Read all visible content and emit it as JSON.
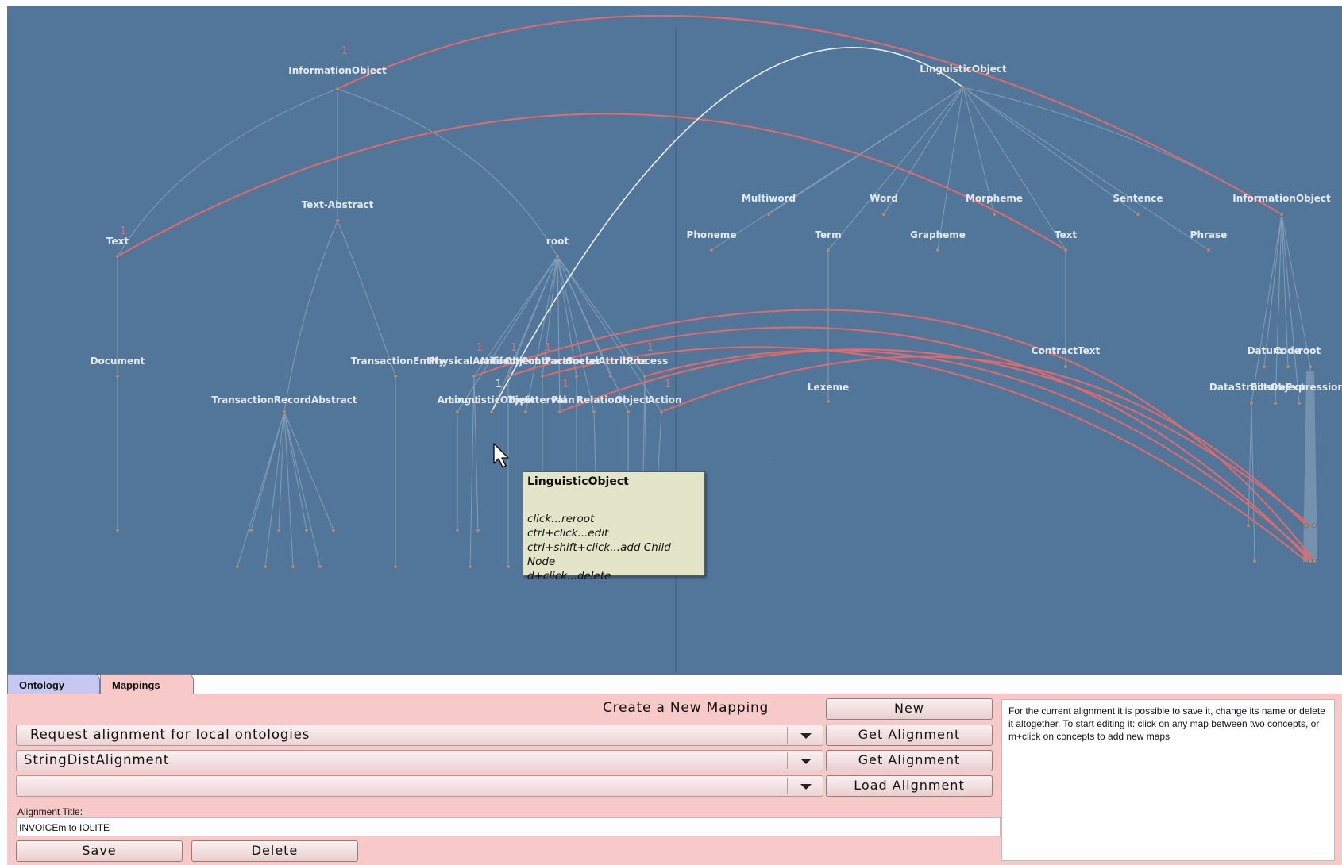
{
  "colors": {
    "canvas_bg": "#51769a",
    "edge_tree": "#8ea4bc",
    "edge_mapping": "#e26a6a",
    "edge_highlight": "#e8edf2",
    "panel_bg": "#f8c9c9"
  },
  "graph": {
    "left_labels": [
      "InformationObject",
      "Text-Abstract",
      "Text",
      "root",
      "Document",
      "TransactionEntity",
      "PhysicalArtifact",
      "Artifact",
      "Object",
      "Contract",
      "Parameter",
      "SocialAttribute",
      "Process",
      "TransactionRecordAbstract",
      "Amount",
      "LinguisticObject",
      "Topic",
      "Interval",
      "Plan",
      "Relation",
      "Object",
      "Action"
    ],
    "right_labels": [
      "LinguisticObject",
      "Multiword",
      "Word",
      "Morpheme",
      "Sentence",
      "InformationObject",
      "Phoneme",
      "Term",
      "Grapheme",
      "Text",
      "Phrase",
      "ContractText",
      "Lexeme",
      "Datum",
      "Code",
      "root",
      "DataStructure",
      "FileObject",
      "Expression"
    ],
    "mapping_counts": [
      "1",
      "1",
      "1",
      "1",
      "1",
      "1",
      "1",
      "1",
      "1"
    ]
  },
  "tooltip": {
    "title": "LinguisticObject",
    "lines": [
      "click...reroot",
      "ctrl+click...edit",
      "ctrl+shift+click...add Child Node",
      "d+click...delete"
    ]
  },
  "tabs": {
    "ontology": "Ontology",
    "mappings": "Mappings"
  },
  "panel": {
    "create_label": "Create a New Mapping",
    "new_button": "New",
    "select1_value": "Request alignment for local ontologies",
    "get_alignment_1": "Get Alignment",
    "select2_value": "StringDistAlignment",
    "get_alignment_2": "Get Alignment",
    "select3_value": "",
    "load_alignment": "Load Alignment",
    "title_label": "Alignment Title:",
    "title_value": "INVOICEm to IOLITE",
    "save_button": "Save",
    "delete_button": "Delete",
    "info_text": "For the current alignment it is possible to save it, change its name or delete it altogether. To start editing it: click on any map between two concepts, or m+click on concepts to add new maps"
  }
}
